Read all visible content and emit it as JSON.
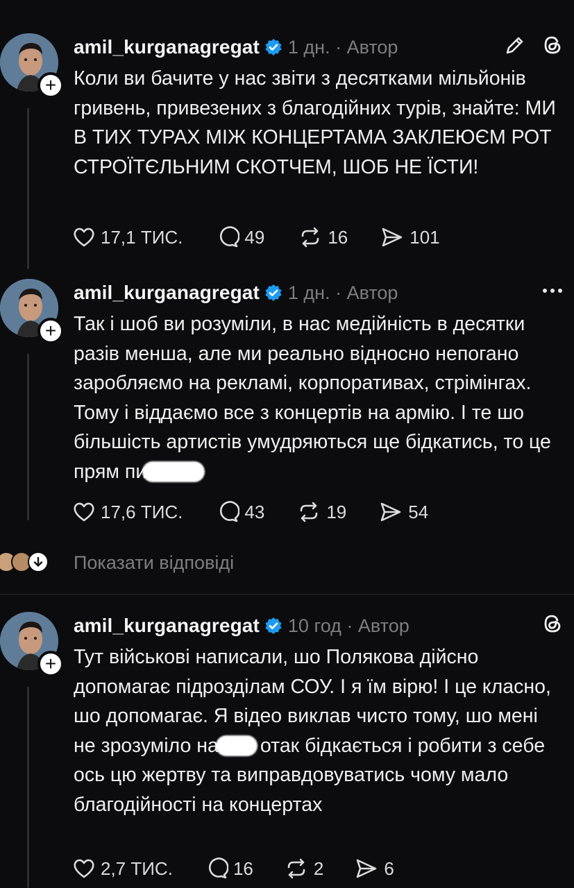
{
  "posts": [
    {
      "username": "amil_kurganagregat",
      "meta": "1 дн. · Автор",
      "text": "Коли ви бачите у нас звіти з десятками мільйонів гривень, привезених з благодійних турів, знайте: МИ В ТИХ ТУРАХ МІЖ КОНЦЕРТАМА ЗАКЛЕЮЄМ РОТ СТРОЇТЄЛЬНИМ СКОТЧЕМ, ШОБ НЕ ЇСТИ!",
      "likes": "17,1 ТИС.",
      "comments": "49",
      "reposts": "16",
      "shares": "101"
    },
    {
      "username": "amil_kurganagregat",
      "meta": "1 дн. · Автор",
      "text": "Так і шоб ви розуміли, в нас медійність в десятки разів менша, але ми реально відносно непогано заробляємо на рекламі, корпоративах, стрімінгах. Тому і віддаємо все з концертів на армію. І те шо більшість артистів умудряються ще бідкатись, то це прям пи",
      "likes": "17,6 ТИС.",
      "comments": "43",
      "reposts": "19",
      "shares": "54"
    },
    {
      "username": "amil_kurganagregat",
      "meta": "10 год · Автор",
      "text_before": "Тут військові написали, шо Полякова дійсно допомагає підрозділам СОУ. І я їм вірю! І це класно, шо допомагає. Я відео виклав чисто тому, шо мені не зрозуміло на",
      "text_after": "отак бідкається і робити з себе ось цю жертву та виправдовуватись чому мало благодійності на концертах",
      "likes": "2,7 ТИС.",
      "comments": "16",
      "reposts": "2",
      "shares": "6"
    }
  ],
  "show_replies": "Показати відповіді",
  "colors": {
    "background": "#0c0c0e",
    "verified": "#1d9bf0",
    "muted": "#7d7d82"
  }
}
